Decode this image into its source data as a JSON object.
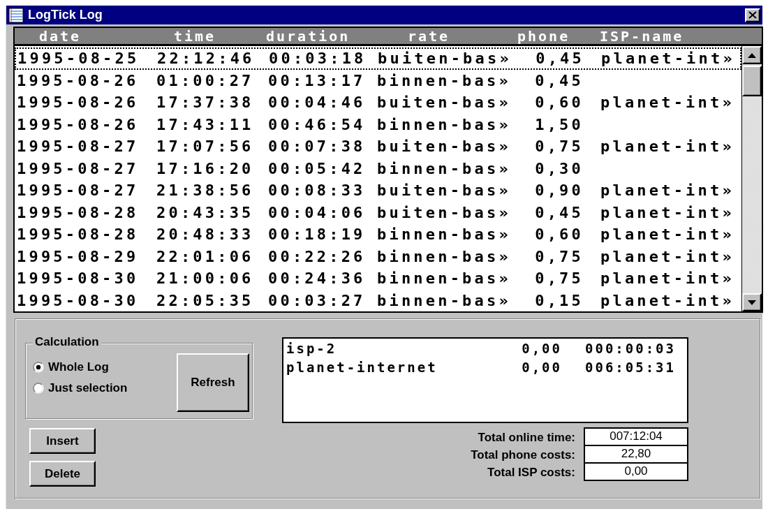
{
  "window": {
    "title": "LogTick Log"
  },
  "table": {
    "columns": [
      "date",
      "time",
      "duration",
      "rate",
      "phone",
      "ISP-name"
    ],
    "rows": [
      {
        "cells": [
          "1995-08-25",
          "22:12:46",
          "00:03:18",
          "buiten-bas»",
          "0,45",
          "planet-int»"
        ],
        "focused": true
      },
      {
        "cells": [
          "1995-08-26",
          "01:00:27",
          "00:13:17",
          "binnen-bas»",
          "0,45",
          ""
        ],
        "focused": false
      },
      {
        "cells": [
          "1995-08-26",
          "17:37:38",
          "00:04:46",
          "buiten-bas»",
          "0,60",
          "planet-int»"
        ],
        "focused": false
      },
      {
        "cells": [
          "1995-08-26",
          "17:43:11",
          "00:46:54",
          "binnen-bas»",
          "1,50",
          ""
        ],
        "focused": false
      },
      {
        "cells": [
          "1995-08-27",
          "17:07:56",
          "00:07:38",
          "buiten-bas»",
          "0,75",
          "planet-int»"
        ],
        "focused": false
      },
      {
        "cells": [
          "1995-08-27",
          "17:16:20",
          "00:05:42",
          "binnen-bas»",
          "0,30",
          ""
        ],
        "focused": false
      },
      {
        "cells": [
          "1995-08-27",
          "21:38:56",
          "00:08:33",
          "buiten-bas»",
          "0,90",
          "planet-int»"
        ],
        "focused": false
      },
      {
        "cells": [
          "1995-08-28",
          "20:43:35",
          "00:04:06",
          "buiten-bas»",
          "0,45",
          "planet-int»"
        ],
        "focused": false
      },
      {
        "cells": [
          "1995-08-28",
          "20:48:33",
          "00:18:19",
          "binnen-bas»",
          "0,60",
          "planet-int»"
        ],
        "focused": false
      },
      {
        "cells": [
          "1995-08-29",
          "22:01:06",
          "00:22:26",
          "binnen-bas»",
          "0,75",
          "planet-int»"
        ],
        "focused": false
      },
      {
        "cells": [
          "1995-08-30",
          "21:00:06",
          "00:24:36",
          "binnen-bas»",
          "0,75",
          "planet-int»"
        ],
        "focused": false
      },
      {
        "cells": [
          "1995-08-30",
          "22:05:35",
          "00:03:27",
          "binnen-bas»",
          "0,15",
          "planet-int»"
        ],
        "focused": false
      }
    ]
  },
  "calculation": {
    "title": "Calculation",
    "options": [
      {
        "label": "Whole Log",
        "selected": true
      },
      {
        "label": "Just selection",
        "selected": false
      }
    ],
    "refresh_button": "Refresh"
  },
  "buttons": [
    "Insert",
    "Delete"
  ],
  "summary": [
    {
      "name": "isp-2",
      "cost": "0,00",
      "time": "000:00:03"
    },
    {
      "name": "planet-internet",
      "cost": "0,00",
      "time": "006:05:31"
    }
  ],
  "totals": [
    {
      "label": "Total online time:",
      "value": "007:12:04"
    },
    {
      "label": "Total phone costs:",
      "value": "22,80"
    },
    {
      "label": "Total ISP costs:",
      "value": "0,00"
    }
  ]
}
